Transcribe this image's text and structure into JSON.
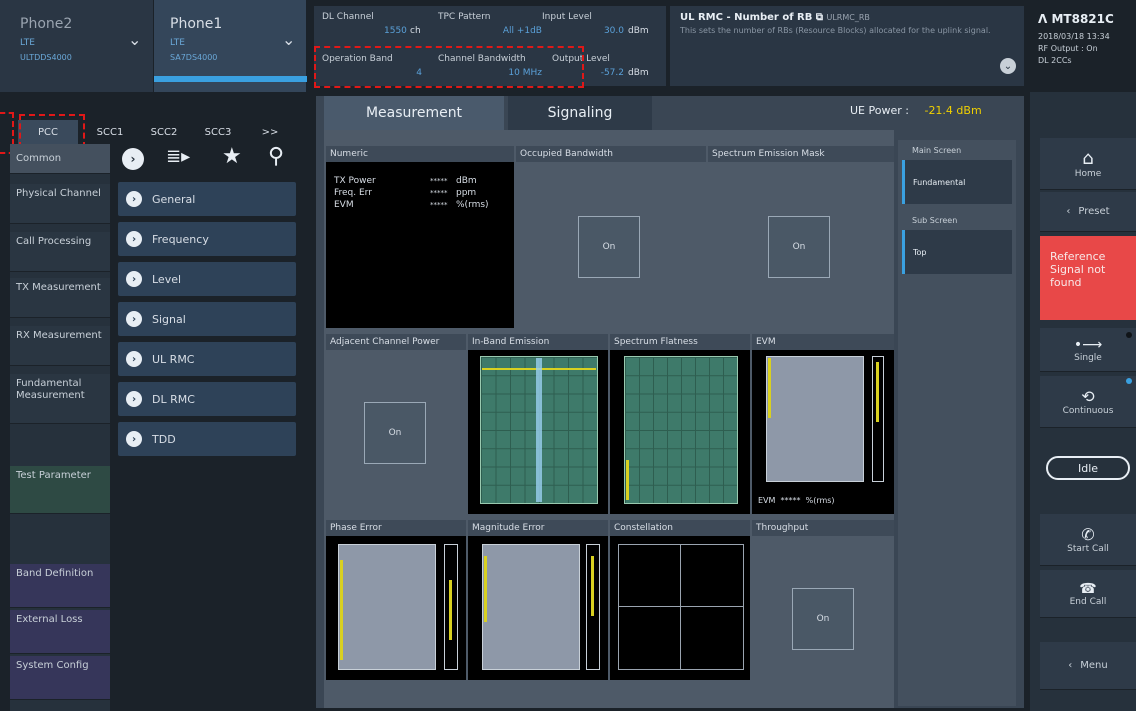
{
  "phones": [
    {
      "name": "Phone2",
      "tech": "LTE",
      "id": "ULTDDS4000"
    },
    {
      "name": "Phone1",
      "tech": "LTE",
      "id": "SA7DS4000"
    }
  ],
  "params": {
    "dl_channel": {
      "label": "DL Channel",
      "value": "1550",
      "unit": "ch"
    },
    "tpc_pattern": {
      "label": "TPC Pattern",
      "value": "All +1dB",
      "unit": ""
    },
    "input_level": {
      "label": "Input Level",
      "value": "30.0",
      "unit": "dBm"
    },
    "operation_band": {
      "label": "Operation Band",
      "value": "4",
      "unit": ""
    },
    "channel_bandwidth": {
      "label": "Channel Bandwidth",
      "value": "10 MHz",
      "unit": ""
    },
    "output_level": {
      "label": "Output Level",
      "value": "-57.2",
      "unit": "dBm"
    }
  },
  "info": {
    "title": "UL RMC - Number of RB",
    "code": "ULRMC_RB",
    "desc": "This sets the number of RBs (Resource Blocks) allocated for the uplink signal."
  },
  "device": {
    "model": "MT8821C",
    "datetime": "2018/03/18 13:34",
    "rf_output": "RF Output : On",
    "dl": "DL 2CCs"
  },
  "cc_tabs": [
    "PCC",
    "SCC1",
    "SCC2",
    "SCC3",
    ">>"
  ],
  "left_menu": [
    "Common",
    "Physical Channel",
    "Call Processing",
    "TX Measurement",
    "RX Measurement",
    "Fundamental Measurement",
    "Test Parameter",
    "Band Definition",
    "External Loss",
    "System Config"
  ],
  "sub_menu": [
    "General",
    "Frequency",
    "Level",
    "Signal",
    "UL RMC",
    "DL RMC",
    "TDD"
  ],
  "main_tabs": {
    "measurement": "Measurement",
    "signaling": "Signaling"
  },
  "ue_power": {
    "label": "UE Power :",
    "value": "-21.4 dBm"
  },
  "numeric": {
    "title": "Numeric",
    "rows": [
      {
        "name": "TX Power",
        "value": "*****",
        "unit": "dBm"
      },
      {
        "name": "Freq. Err",
        "value": "*****",
        "unit": "ppm"
      },
      {
        "name": "EVM",
        "value": "*****",
        "unit": "%(rms)"
      }
    ]
  },
  "panels": {
    "obw": "Occupied Bandwidth",
    "sem": "Spectrum Emission Mask",
    "acp": "Adjacent Channel Power",
    "ibe": "In-Band Emission",
    "flat": "Spectrum Flatness",
    "evm": "EVM",
    "evm_readout": "EVM  *****  %(rms)",
    "phase": "Phase Error",
    "mag": "Magnitude Error",
    "const": "Constellation",
    "thr": "Throughput",
    "on": "On"
  },
  "screens": {
    "main_label": "Main Screen",
    "main_value": "Fundamental",
    "sub_label": "Sub Screen",
    "sub_value": "Top"
  },
  "right_panel": {
    "home": "Home",
    "preset": "Preset",
    "alert": "Reference Signal not found",
    "single": "Single",
    "continuous": "Continuous",
    "idle": "Idle",
    "start_call": "Start Call",
    "end_call": "End Call",
    "menu": "Menu"
  },
  "colors": {
    "accent": "#5aa0d8",
    "alert": "#e84848",
    "power": "#f0d000"
  }
}
